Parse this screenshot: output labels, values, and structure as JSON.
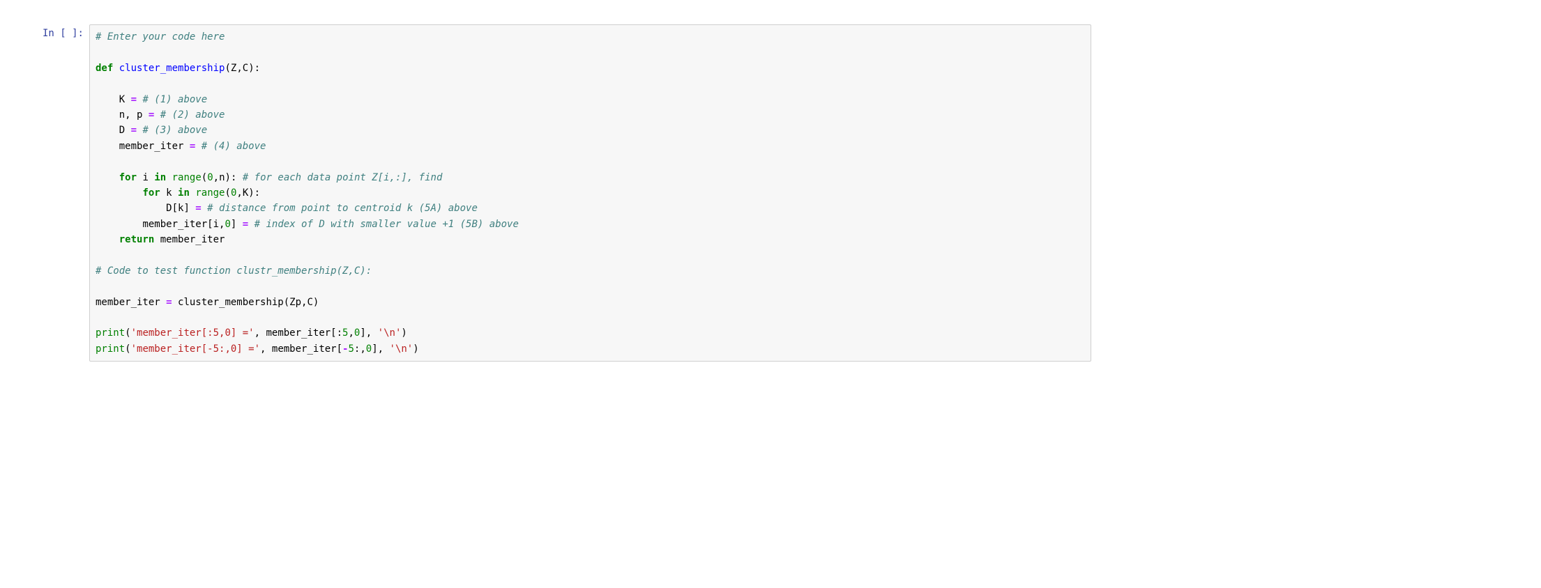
{
  "cell": {
    "prompt_label": "In [ ]:",
    "code": {
      "l01_comment": "# Enter your code here",
      "l02_blank": "",
      "l03": {
        "kw_def": "def",
        "fn": "cluster_membership",
        "sig_open": "(",
        "p1": "Z",
        "comma": ",",
        "p2": "C",
        "sig_close": "):"
      },
      "l04_blank": "",
      "l05": {
        "indent": "    ",
        "var": "K",
        "eq": " = ",
        "comment": "# (1) above"
      },
      "l06": {
        "indent": "    ",
        "var": "n, p",
        "eq": " = ",
        "comment": "# (2) above"
      },
      "l07": {
        "indent": "    ",
        "var": "D",
        "eq": " = ",
        "comment": "# (3) above"
      },
      "l08": {
        "indent": "    ",
        "var": "member_iter",
        "eq": " = ",
        "comment": "# (4) above"
      },
      "l09_blank": "",
      "l10": {
        "indent": "    ",
        "kw_for": "for",
        "var_i": "i",
        "kw_in": "in",
        "fn_range": "range",
        "args_open": "(",
        "n0": "0",
        "comma": ",",
        "arg_n": "n",
        "args_close": "):",
        "comment": " # for each data point Z[i,:], find"
      },
      "l11": {
        "indent": "        ",
        "kw_for": "for",
        "var_k": "k",
        "kw_in": "in",
        "fn_range": "range",
        "args_open": "(",
        "n0": "0",
        "comma": ",",
        "arg_K": "K",
        "args_close": "):"
      },
      "l12": {
        "indent": "            ",
        "lhs": "D[k]",
        "eq": " = ",
        "comment": "# distance from point to centroid k (5A) above"
      },
      "l13": {
        "indent": "        ",
        "lhs_a": "member_iter[i,",
        "n0": "0",
        "lhs_b": "]",
        "eq": " = ",
        "comment": "# index of D with smaller value +1 (5B) above"
      },
      "l14": {
        "indent": "    ",
        "kw_return": "return",
        "sp": " ",
        "var": "member_iter"
      },
      "l15_blank": "",
      "l16_comment": "# Code to test function clustr_membership(Z,C):",
      "l17_blank": "",
      "l18": {
        "lhs": "member_iter",
        "eq": " = ",
        "fn": "cluster_membership",
        "args_open": "(",
        "a1": "Zp",
        "comma": ",",
        "a2": "C",
        "args_close": ")"
      },
      "l19_blank": "",
      "l20": {
        "fn": "print",
        "open": "(",
        "s1": "'member_iter[:5,0] ='",
        "c1": ", ",
        "expr_a": "member_iter[:",
        "n5": "5",
        "expr_b": ",",
        "n0": "0",
        "expr_c": "]",
        "c2": ", ",
        "s2": "'\\n'",
        "close": ")"
      },
      "l21": {
        "fn": "print",
        "open": "(",
        "s1": "'member_iter[-5:,0] ='",
        "c1": ", ",
        "expr_a": "member_iter[",
        "neg": "-",
        "n5": "5",
        "expr_b": ":,",
        "n0": "0",
        "expr_c": "]",
        "c2": ", ",
        "s2": "'\\n'",
        "close": ")"
      }
    }
  }
}
